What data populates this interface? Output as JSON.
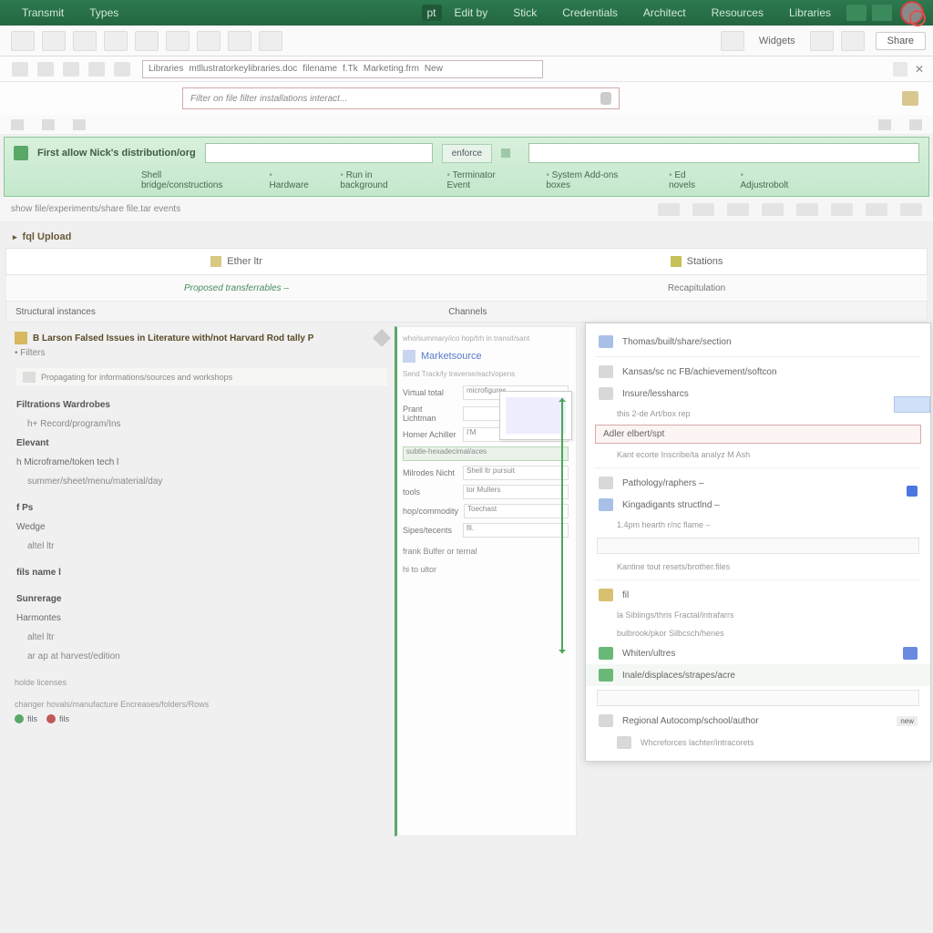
{
  "menu": {
    "items": [
      "Transmit",
      "Types"
    ],
    "right": [
      "Edit by",
      "Stick",
      "Credentials",
      "Architect",
      "Resources",
      "Libraries"
    ],
    "pill": "pt"
  },
  "ribbon": {
    "label": "Widgets",
    "share": "Share"
  },
  "path": {
    "segs": [
      "Libraries",
      "mtllustratorkeylibraries.doc",
      "filename",
      "f.Tk",
      "Marketing.frm",
      "New"
    ]
  },
  "search": {
    "placeholder": "Filter on file filter installations  interact..."
  },
  "qband": {
    "label": "First allow Nick's distribution/org",
    "btn": "enforce",
    "tabs": [
      "Shell bridge/constructions",
      "Hardware",
      "Run in background",
      "Terminator Event",
      "System Add-ons boxes",
      "Ed novels",
      "Adjustrobolt"
    ]
  },
  "fstrip": {
    "hint": "show  file/experiments/share  file.tar  events"
  },
  "section": "fql Upload",
  "tabs": {
    "left": "Ether ltr",
    "right": "Stations"
  },
  "subtabs": {
    "left": "Proposed transferrables  –",
    "right": "Recapitulation"
  },
  "headers": {
    "left": "Structural instances",
    "right": "Channels"
  },
  "left": {
    "title": "B Larson  Falsed Issues in Literature with/not Harvard Rod tally  P",
    "sub": "Filters",
    "boxline": "Propagating for informations/sources and workshops",
    "g1": [
      "Filtrations Wardrobes",
      "h+ Record/program/Ins",
      "Elevant",
      "h Microframe/token tech l",
      "summer/sheet/menu/material/day"
    ],
    "g2": [
      "f Ps",
      "Wedge",
      "altel ltr"
    ],
    "g3": [
      "fils name l"
    ],
    "g4": [
      "Sunrerage",
      "Harmontes",
      "altel ltr",
      "ar ap  at harvest/edition"
    ],
    "footlabel": "holde licenses",
    "foot": "changer  hovals/manufacture  Encreases/folders/Rows",
    "chips": [
      {
        "c": "#5aa868",
        "t": "fils"
      },
      {
        "c": "#c05858",
        "t": "fils"
      }
    ]
  },
  "mid": {
    "pretitle": "who/summary/ico  hop/trh  in transit/sant",
    "title": "Marketsource",
    "hint": "Send Track/ly traverse/each/opens",
    "rows": [
      {
        "l": "Virtual total",
        "v": "microfigures"
      },
      {
        "l": "Prant Lichtman",
        "v": ""
      },
      {
        "l": "Homer Achiller",
        "v": "I'M"
      },
      {
        "l": "",
        "v": "subtle-hexadecimal/aces",
        "sel": true
      },
      {
        "l": "Milrodes Nicht",
        "v": "Shell ltr   pursuit"
      },
      {
        "l": "tools",
        "v": "tor Mullers"
      },
      {
        "l": "hop/commodity",
        "v": "Toechast"
      },
      {
        "l": "Sipes/tecents",
        "v": "fil."
      }
    ],
    "foot1": "frank Bulfer or ternal",
    "foot2": "hi  to ultor"
  },
  "right": {
    "items": [
      {
        "t": "Thomas/built/share/section",
        "ico": "b"
      },
      {
        "t": "Kansas/sc  nc  FB/achievement/softcon",
        "ico": ""
      },
      {
        "t": "Insure/lessharcs",
        "ico": ""
      },
      {
        "t": "this  2-de Art/box  rep",
        "sub": true
      },
      {
        "t": "Adler elbert/spt",
        "hl": true
      },
      {
        "t": "Kant ecorte Inscribe/ta  analyz M Ash",
        "sub": true
      },
      {
        "t": "Pathology/raphers –",
        "ico": ""
      },
      {
        "t": "Kingadigants structlnd –",
        "ico": "b"
      },
      {
        "t": "1.4pm  hearth r/nc flame –",
        "sub": true
      },
      {
        "t": "",
        "input": true
      },
      {
        "t": "Kantine tout resets/brother.files",
        "sub": true
      },
      {
        "t": "fil",
        "ico": "y"
      },
      {
        "t": "la Siblings/thris Fractal/intrafarrs",
        "sub": true
      },
      {
        "t": "bulbrook/pkor  Silbcsch/henes",
        "sub": true
      },
      {
        "t": "Whiten/ultres",
        "ico": "g",
        "badge": true
      },
      {
        "t": "Inale/displaces/strapes/acre",
        "ico": "g",
        "sel": true
      },
      {
        "t": "",
        "input": true
      },
      {
        "t": "Regional  Autocomp/school/author",
        "ico": "",
        "tag": "new"
      },
      {
        "t": "Whcreforces lachter/intracorets",
        "ico": "",
        "sub2": true
      }
    ]
  }
}
